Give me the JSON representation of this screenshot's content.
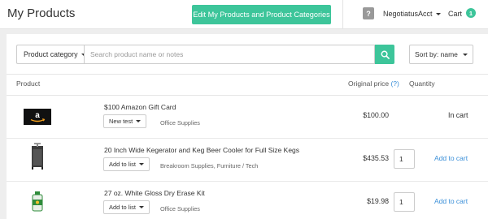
{
  "header": {
    "title": "My Products",
    "edit_button": "Edit My Products and Product Categories",
    "help": "?",
    "account": "NegotiatusAcct",
    "cart_label": "Cart",
    "cart_count": "1"
  },
  "filters": {
    "category_label": "Product category",
    "search_placeholder": "Search product name or notes",
    "sort_label": "Sort by: name"
  },
  "columns": {
    "product": "Product",
    "original_price": "Original price",
    "price_info": "(?)",
    "quantity": "Quantity"
  },
  "products": [
    {
      "name": "$100 Amazon Gift Card",
      "list_button": "New test",
      "categories": "Office Supplies",
      "price": "$100.00",
      "status": "In cart",
      "image_icon": "amazon-logo"
    },
    {
      "name": "20 Inch Wide Kegerator and Keg Beer Cooler for Full Size Kegs",
      "list_button": "Add to list",
      "categories": "Breakroom Supplies, Furniture / Tech",
      "price": "$435.53",
      "quantity": "1",
      "action": "Add to cart",
      "image_icon": "kegerator-image"
    },
    {
      "name": "27 oz. White Gloss Dry Erase Kit",
      "list_button": "Add to list",
      "categories": "Office Supplies",
      "price": "$19.98",
      "quantity": "1",
      "action": "Add to cart",
      "image_icon": "dry-erase-kit-image"
    }
  ],
  "colors": {
    "accent_green": "#3dc59a",
    "link_blue": "#3a8fd8"
  }
}
